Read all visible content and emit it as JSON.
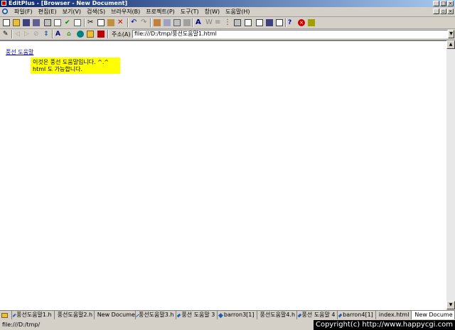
{
  "window": {
    "title": "EditPlus - [Browser - New Document]"
  },
  "menu": [
    "파일(F)",
    "편집(E)",
    "보기(V)",
    "검색(S)",
    "브라우저(B)",
    "프로젝트(P)",
    "도구(T)",
    "창(W)",
    "도움말(H)"
  ],
  "address": {
    "label": "주소(A)",
    "value": "file:///D:/tmp/풍선도움말1.html"
  },
  "page": {
    "link_text": "풍선 도움말",
    "tooltip_line1": "이것은 풍선 도움말입니다. ^.^",
    "tooltip_line2": "html 도 가능합니다."
  },
  "tabs": [
    "풍선도움말1.h",
    "풍선도움말2.h",
    "New Docume",
    "풍선도움말3.h",
    "풍선 도움말 3",
    "barron3[1]",
    "풍선도움말4.h",
    "풍선 도움말 4",
    "barron4[1]",
    "index.html",
    "New Docume"
  ],
  "active_tab_index": 10,
  "status": {
    "path": "file:///D:/tmp/"
  },
  "watermark": "Copyright(c) http://www.happycgi.com"
}
